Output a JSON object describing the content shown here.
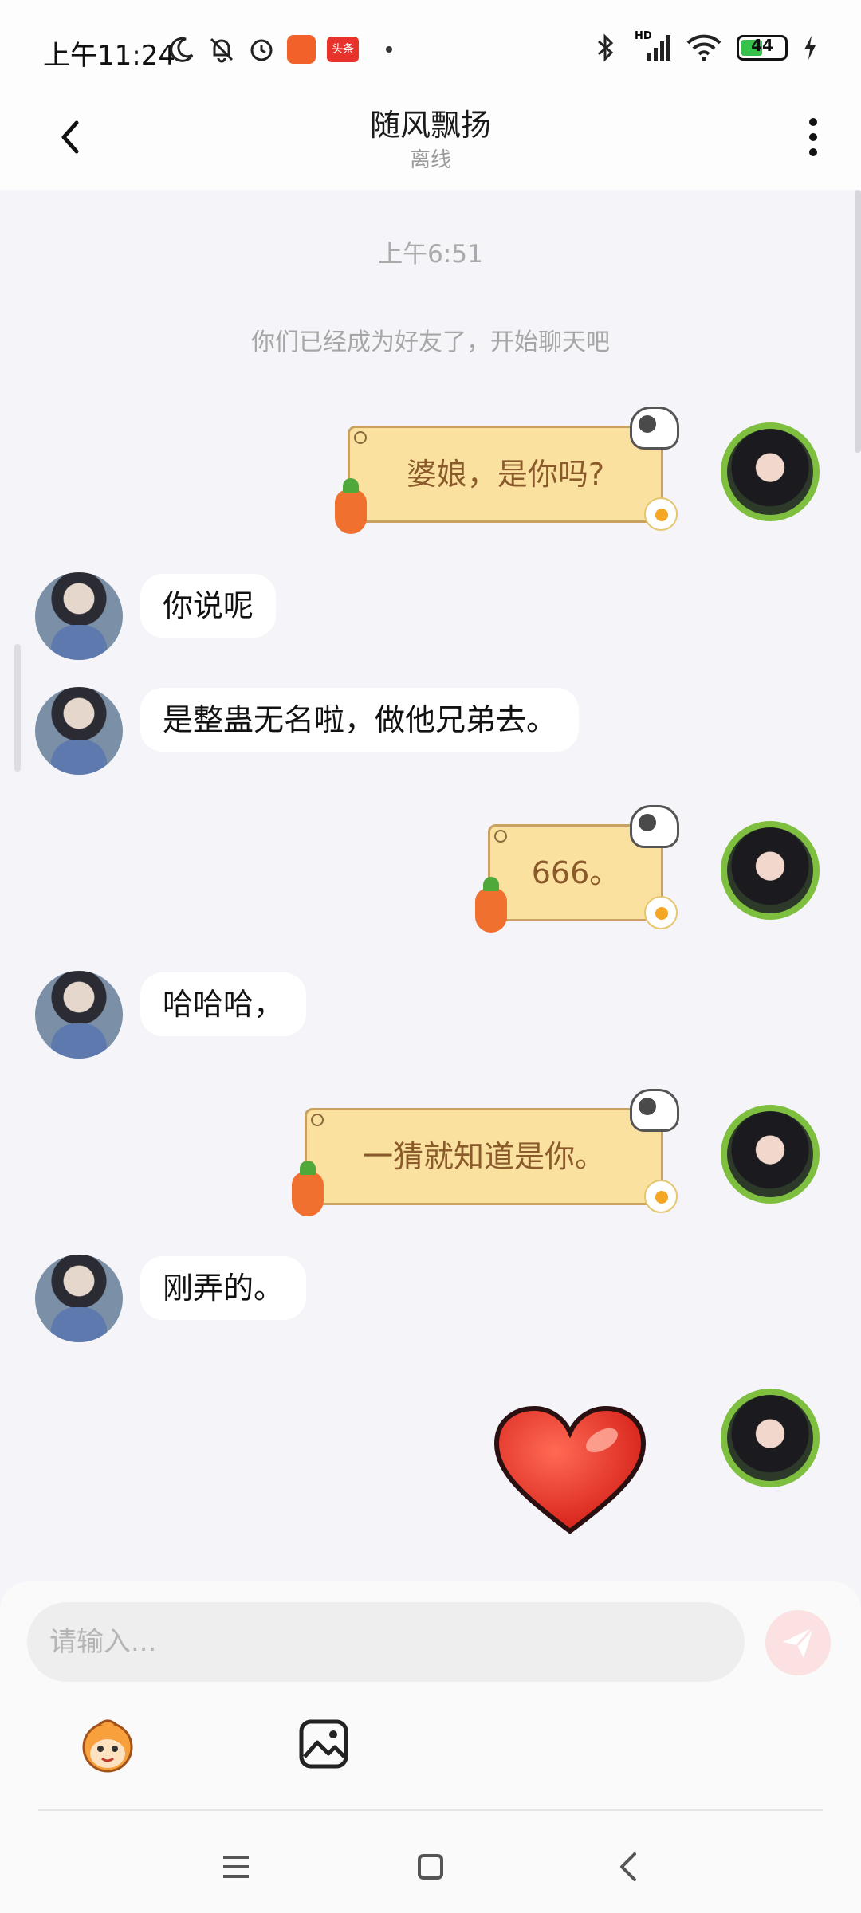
{
  "status_bar": {
    "time": "上午11:24",
    "news_app_label": "头条",
    "battery_level": "44",
    "signal_label": "HD"
  },
  "header": {
    "title": "随风飘扬",
    "status": "离线"
  },
  "chat": {
    "timestamp": "上午6:51",
    "system_note": "你们已经成为好友了，开始聊天吧",
    "messages": [
      {
        "sender": "me",
        "text": "婆娘，是你吗?"
      },
      {
        "sender": "friend",
        "text": "你说呢"
      },
      {
        "sender": "friend",
        "text": "是整蛊无名啦，做他兄弟去。"
      },
      {
        "sender": "me",
        "text": "666。"
      },
      {
        "sender": "friend",
        "text": "哈哈哈，"
      },
      {
        "sender": "me",
        "text": "一猜就知道是你。"
      },
      {
        "sender": "friend",
        "text": "刚弄的。"
      },
      {
        "sender": "me",
        "sticker": "heart"
      }
    ]
  },
  "input": {
    "placeholder": "请输入..."
  },
  "colors": {
    "my_bubble": "#fbe1a0",
    "my_bubble_text": "#8a5a2a",
    "friend_bubble": "#ffffff",
    "send_button": "#fbe1e1",
    "background": "#f4f4f9"
  },
  "icons": [
    "bluetooth-icon",
    "signal-icon",
    "wifi-icon",
    "battery-icon",
    "moon-icon",
    "bell-off-icon",
    "alarm-icon",
    "back-icon",
    "more-icon",
    "send-icon",
    "emoji-icon",
    "image-icon",
    "menu-icon",
    "home-icon",
    "nav-back-icon"
  ]
}
